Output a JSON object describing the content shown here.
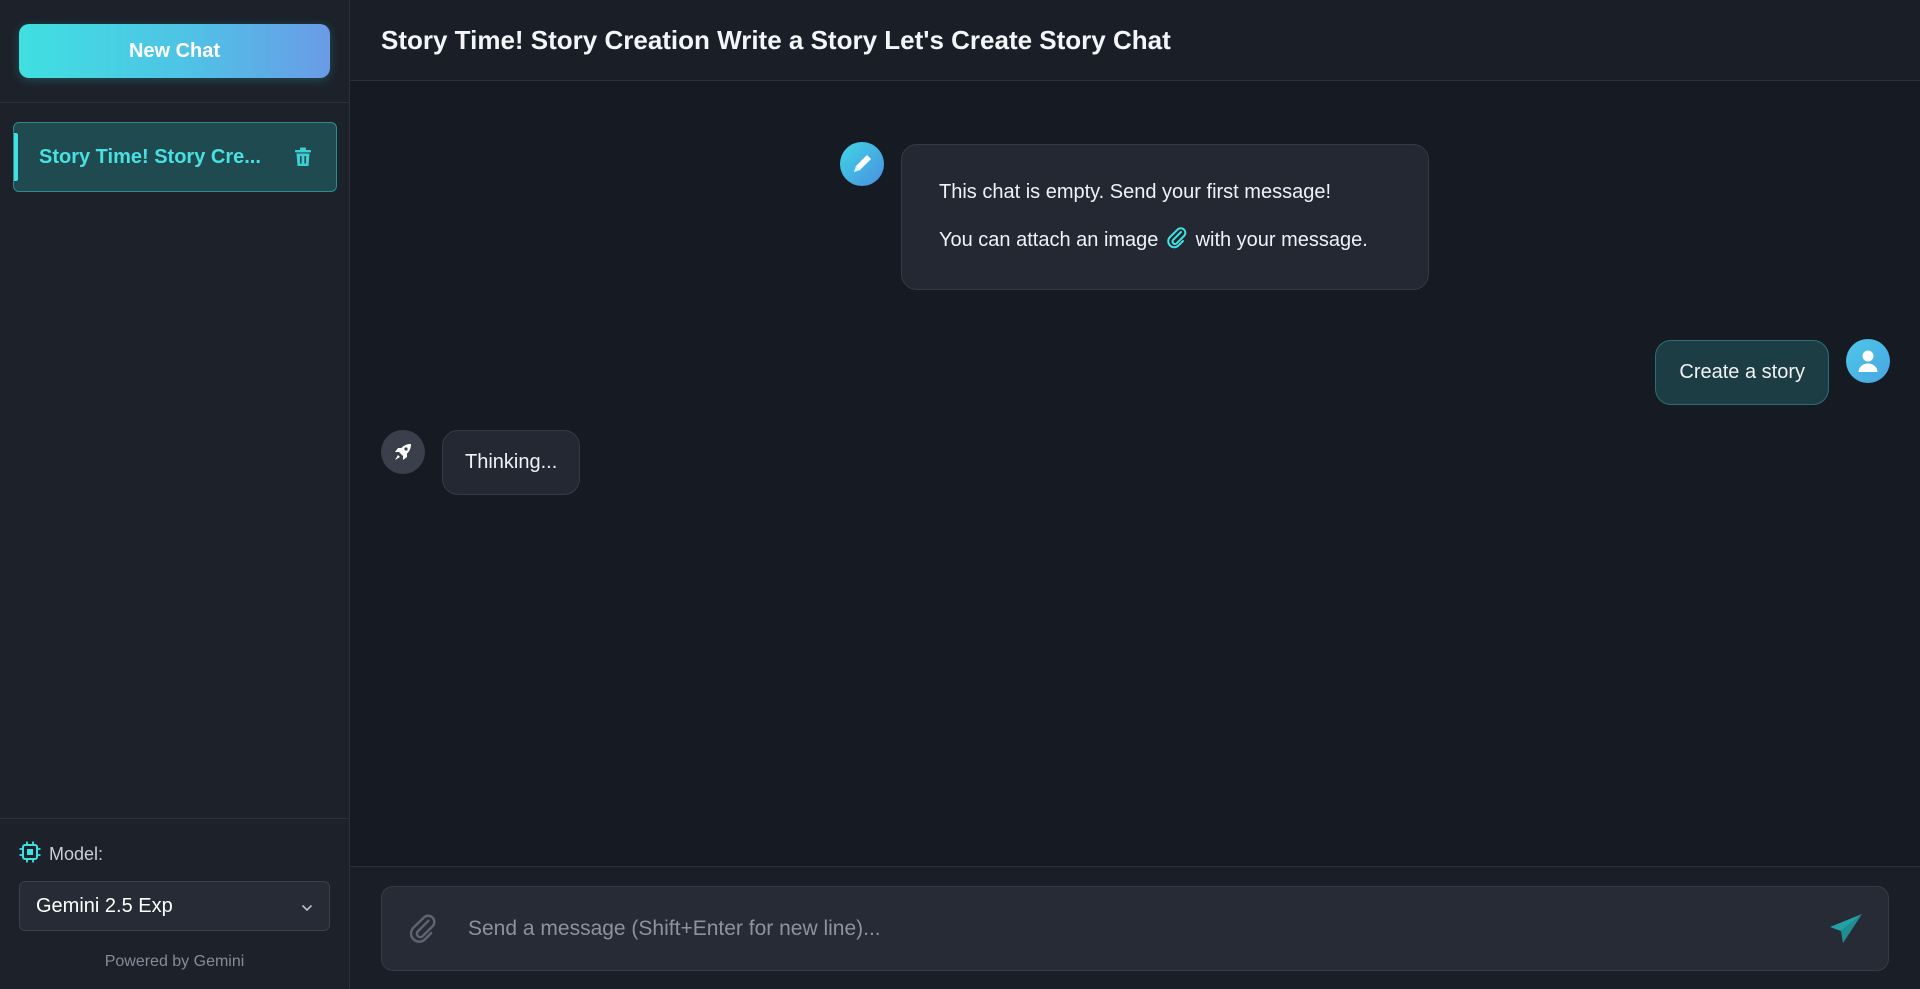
{
  "sidebar": {
    "new_chat_label": "New Chat",
    "chats": [
      {
        "label": "Story Time! Story Cre...",
        "active": true
      }
    ],
    "model_label": "Model:",
    "model_value": "Gemini 2.5 Exp",
    "powered_by": "Powered by Gemini"
  },
  "header": {
    "title": "Story Time! Story Creation Write a Story Let's Create Story Chat"
  },
  "messages": {
    "welcome_line1": "This chat is empty. Send your first message!",
    "welcome_line2_prefix": "You can attach an image",
    "welcome_line2_suffix": "with your message.",
    "user_message": "Create a story",
    "bot_status": "Thinking..."
  },
  "composer": {
    "placeholder": "Send a message (Shift+Enter for new line)..."
  },
  "colors": {
    "accent": "#3fe0e0",
    "accent_blue": "#4fb8e8",
    "background": "#161a22",
    "sidebar": "#1c212a",
    "active_item": "#1f4a50",
    "user_bubble": "#1c3d43"
  },
  "icons": {
    "delete": "trash-icon",
    "model": "cpu-chip-icon",
    "select": "chevron-down-icon",
    "welcome_avatar": "pen-icon",
    "user_avatar": "user-icon",
    "bot_avatar": "rocket-icon",
    "attach": "paperclip-icon",
    "send": "send-icon"
  }
}
